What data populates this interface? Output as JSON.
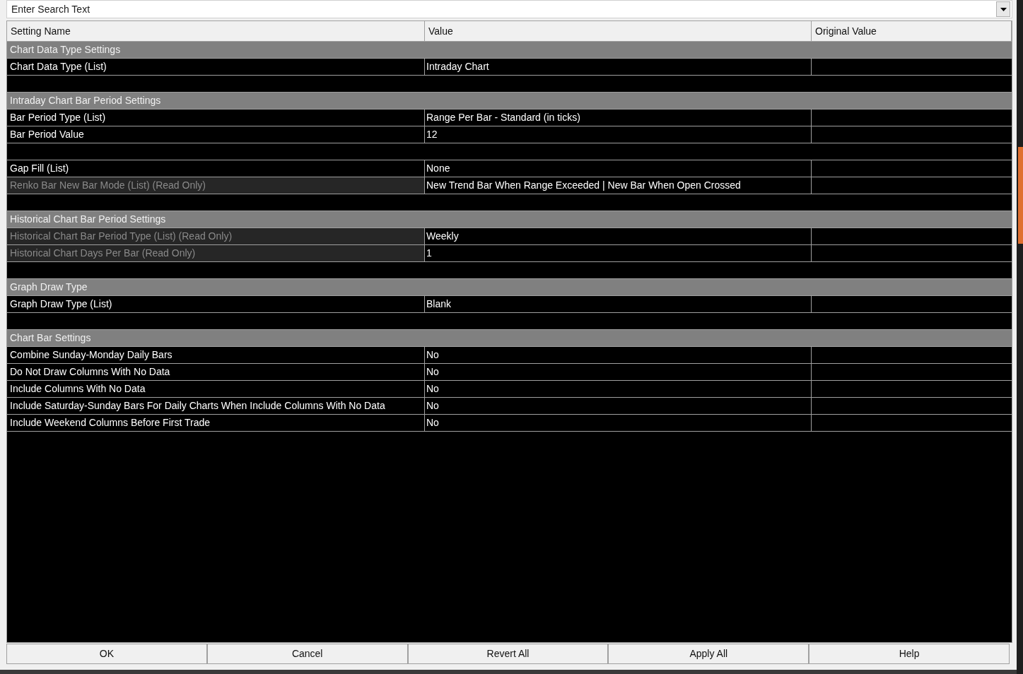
{
  "search": {
    "placeholder": "Enter Search Text"
  },
  "table": {
    "columns": [
      "Setting Name",
      "Value",
      "Original Value"
    ],
    "rows": [
      {
        "kind": "section",
        "name": "Chart Data Type Settings"
      },
      {
        "kind": "setting",
        "name": "Chart Data Type (List)",
        "value": "Intraday Chart",
        "read_only": false
      },
      {
        "kind": "blank"
      },
      {
        "kind": "section",
        "name": "Intraday Chart Bar Period Settings"
      },
      {
        "kind": "setting",
        "name": "Bar Period Type (List)",
        "value": "Range Per Bar - Standard (in ticks)",
        "read_only": false
      },
      {
        "kind": "setting",
        "name": "Bar Period Value",
        "value": "12",
        "read_only": false
      },
      {
        "kind": "blank"
      },
      {
        "kind": "setting",
        "name": "Gap Fill (List)",
        "value": "None",
        "read_only": false
      },
      {
        "kind": "setting",
        "name": "Renko Bar New Bar Mode (List) (Read Only)",
        "value": "New Trend Bar When Range Exceeded | New Bar When Open Crossed",
        "read_only": true
      },
      {
        "kind": "blank"
      },
      {
        "kind": "section",
        "name": "Historical Chart Bar Period Settings"
      },
      {
        "kind": "setting",
        "name": "Historical Chart Bar Period Type (List) (Read Only)",
        "value": "Weekly",
        "read_only": true
      },
      {
        "kind": "setting",
        "name": "Historical Chart Days Per Bar (Read Only)",
        "value": "1",
        "read_only": true
      },
      {
        "kind": "blank"
      },
      {
        "kind": "section",
        "name": "Graph Draw Type"
      },
      {
        "kind": "setting",
        "name": "Graph Draw Type (List)",
        "value": "Blank",
        "read_only": false
      },
      {
        "kind": "blank"
      },
      {
        "kind": "section",
        "name": "Chart Bar Settings"
      },
      {
        "kind": "setting",
        "name": "Combine Sunday-Monday Daily Bars",
        "value": "No",
        "read_only": false
      },
      {
        "kind": "setting",
        "name": "Do Not Draw Columns With No Data",
        "value": "No",
        "read_only": false
      },
      {
        "kind": "setting",
        "name": "Include Columns With No Data",
        "value": "No",
        "read_only": false
      },
      {
        "kind": "setting",
        "name": "Include Saturday-Sunday Bars For Daily Charts When Include Columns With No Data",
        "value": "No",
        "read_only": false
      },
      {
        "kind": "setting",
        "name": "Include Weekend Columns Before First Trade",
        "value": "No",
        "read_only": false
      }
    ]
  },
  "buttons": [
    "OK",
    "Cancel",
    "Revert All",
    "Apply All",
    "Help"
  ]
}
